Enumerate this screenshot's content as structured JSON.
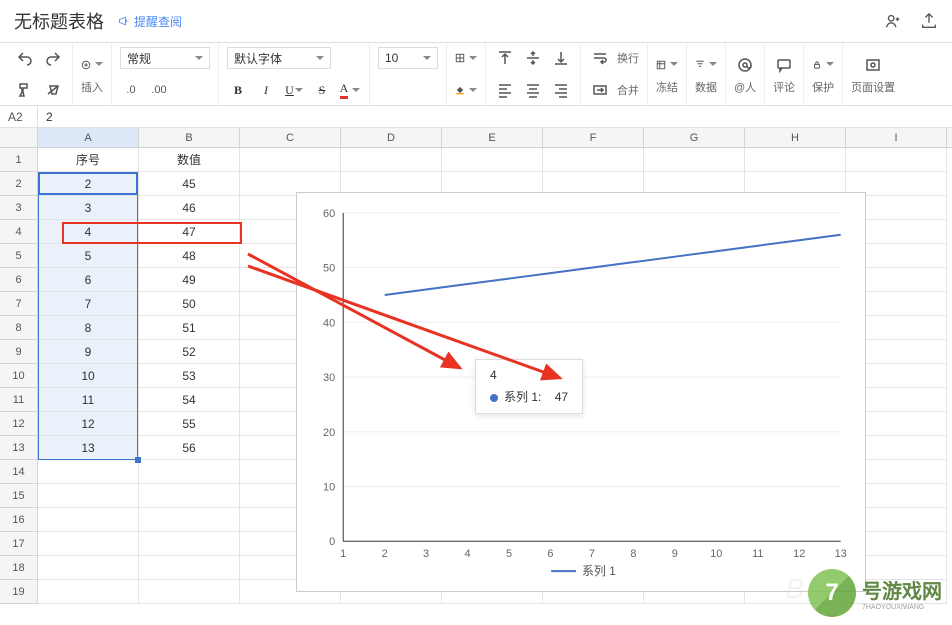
{
  "header": {
    "title": "无标题表格",
    "remind": "提醒查阅"
  },
  "toolbar": {
    "insert": "插入",
    "normal": "常规",
    "dec": ".0",
    "decInc": ".00",
    "font": "默认字体",
    "size": "10",
    "wrap": "换行",
    "merge": "合并",
    "freeze": "冻结",
    "data": "数据",
    "at": "@人",
    "comment": "评论",
    "protect": "保护",
    "page": "页面设置"
  },
  "cellRef": "A2",
  "cellVal": "2",
  "cols": [
    "A",
    "B",
    "C",
    "D",
    "E",
    "F",
    "G",
    "H",
    "I"
  ],
  "rows": [
    "1",
    "2",
    "3",
    "4",
    "5",
    "6",
    "7",
    "8",
    "9",
    "10",
    "11",
    "12",
    "13",
    "14",
    "15",
    "16",
    "17",
    "18",
    "19"
  ],
  "headers": {
    "a": "序号",
    "b": "数值"
  },
  "tableA": [
    "2",
    "3",
    "4",
    "5",
    "6",
    "7",
    "8",
    "9",
    "10",
    "11",
    "12",
    "13"
  ],
  "tableB": [
    "45",
    "46",
    "47",
    "48",
    "49",
    "50",
    "51",
    "52",
    "53",
    "54",
    "55",
    "56"
  ],
  "tooltip": {
    "x": "4",
    "series": "系列 1:",
    "val": "47"
  },
  "legend": {
    "s1": "系列 1"
  },
  "watermark": {
    "num": "7",
    "brand": "号游戏网",
    "sub": "7HAOYOUXIWANG",
    "bg": "Bai"
  },
  "chart_data": {
    "type": "line",
    "x": [
      2,
      3,
      4,
      5,
      6,
      7,
      8,
      9,
      10,
      11,
      12,
      13
    ],
    "series": [
      {
        "name": "系列 1",
        "values": [
          45,
          46,
          47,
          48,
          49,
          50,
          51,
          52,
          53,
          54,
          55,
          56
        ]
      }
    ],
    "ylim": [
      0,
      60
    ],
    "yticks": [
      0,
      10,
      20,
      30,
      40,
      50,
      60
    ],
    "xlim": [
      1,
      13
    ],
    "xticks": [
      1,
      2,
      3,
      4,
      5,
      6,
      7,
      8,
      9,
      10,
      11,
      12,
      13
    ],
    "title": "",
    "xlabel": "",
    "ylabel": ""
  }
}
